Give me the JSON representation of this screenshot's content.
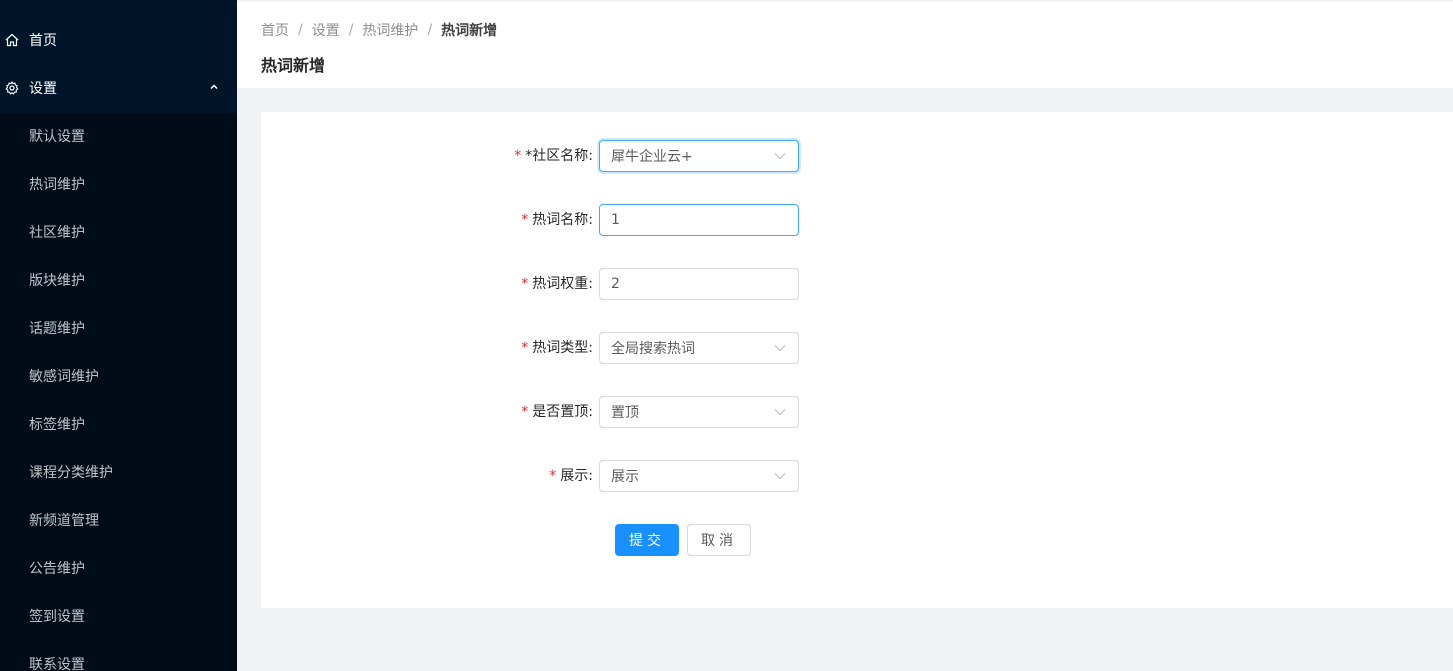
{
  "sidebar": {
    "home_label": "首页",
    "settings_label": "设置",
    "sub_items": [
      "默认设置",
      "热词维护",
      "社区维护",
      "版块维护",
      "话题维护",
      "敏感词维护",
      "标签维护",
      "课程分类维护",
      "新频道管理",
      "公告维护",
      "签到设置",
      "联系设置"
    ]
  },
  "header": {
    "breadcrumb": [
      "首页",
      "设置",
      "热词维护",
      "热词新增"
    ],
    "separator": "/",
    "title": "热词新增"
  },
  "form": {
    "required_mark": "*",
    "community": {
      "label": "*社区名称:",
      "value": "犀牛企业云+"
    },
    "hotword_name": {
      "label": "热词名称:",
      "value": "1"
    },
    "hotword_weight": {
      "label": "热词权重:",
      "value": "2"
    },
    "hotword_type": {
      "label": "热词类型:",
      "value": "全局搜索热词"
    },
    "is_top": {
      "label": "是否置顶:",
      "value": "置顶"
    },
    "display": {
      "label": "展示:",
      "value": "展示"
    },
    "submit_label": "提交",
    "cancel_label": "取消"
  },
  "colors": {
    "sidebar_bg": "#001529",
    "submenu_bg": "#000c17",
    "primary": "#1890ff",
    "required": "#f5222d"
  }
}
